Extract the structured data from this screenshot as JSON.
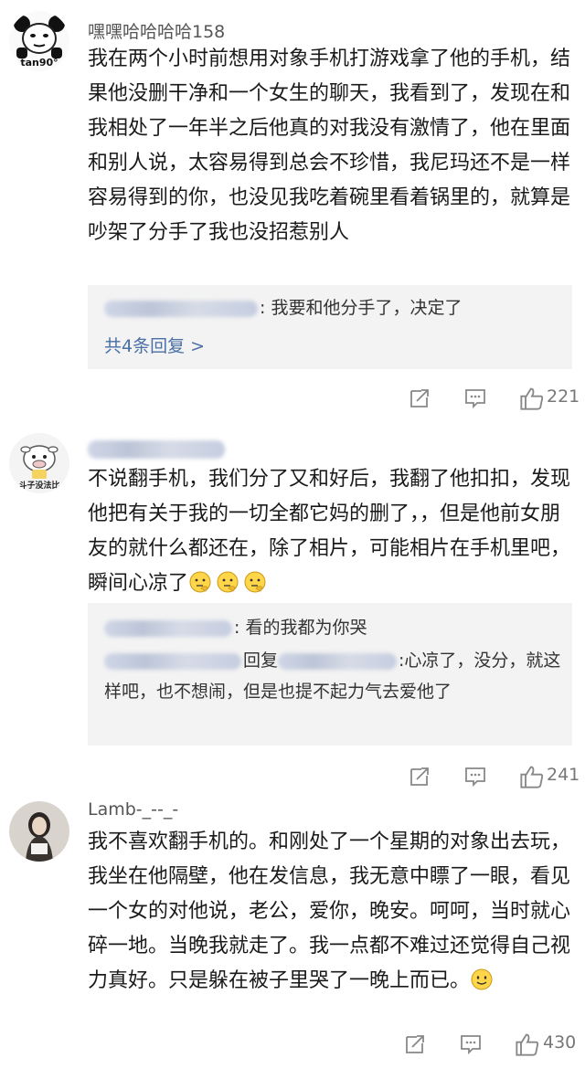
{
  "comments": [
    {
      "username": "嘿嘿哈哈哈哈158",
      "avatar_label": "tan90°",
      "avatar_icon": "panda-meme-avatar-icon",
      "text": "我在两个小时前想用对象手机打游戏拿了他的手机，结果他没删干净和一个女生的聊天，我看到了，发现在和我相处了一年半之后他真的对我没有激情了，他在里面和别人说，太容易得到总会不珍惜，我尼玛还不是一样容易得到的你，也没见我吃着碗里看着锅里的，就算是吵架了分手了我也没招惹别人",
      "reply_lines": [
        {
          "text": ": 我要和他分手了，决定了"
        }
      ],
      "more_replies": "共4条回复 >",
      "likes": "221"
    },
    {
      "username": "",
      "avatar_label": "斗子没法比",
      "avatar_icon": "cartoon-cow-avatar-icon",
      "text": "不说翻手机，我们分了又和好后，我翻了他扣扣，发现他把有关于我的一切全都它妈的删了，，但是他前女朋友的就什么都还在，除了相片，可能相片在手机里吧，瞬间心凉了",
      "emoji_icons": [
        "thinking-emoji-icon",
        "thinking-emoji-icon",
        "thinking-emoji-icon"
      ],
      "reply_lines": [
        {
          "text": ": 看的我都为你哭"
        },
        {
          "mid": "回复",
          "text": ":心凉了，没分，就这样吧，也不想闹，但是也提不起力气去爱他了"
        }
      ],
      "likes": "241"
    },
    {
      "username": "Lamb-_--_-",
      "avatar_icon": "girl-photo-avatar-icon",
      "text": "我不喜欢翻手机的。和刚处了一个星期的对象出去玩，我坐在他隔壁，他在发信息，我无意中瞟了一眼，看见一个女的对他说，老公，爱你，晚安。呵呵，当时就心碎一地。当晚我就走了。我一点都不难过还觉得自己视力真好。只是躲在被子里哭了一晚上而已。",
      "emoji_icons": [
        "smile-emoji-icon"
      ],
      "likes": "430"
    }
  ],
  "action_icons": [
    "share-icon",
    "comment-icon",
    "thumbs-up-icon"
  ],
  "colors": {
    "link": "#4a6fa5",
    "reply_bg": "#f3f3f3",
    "text": "#1a1a1a",
    "meta": "#777777"
  }
}
